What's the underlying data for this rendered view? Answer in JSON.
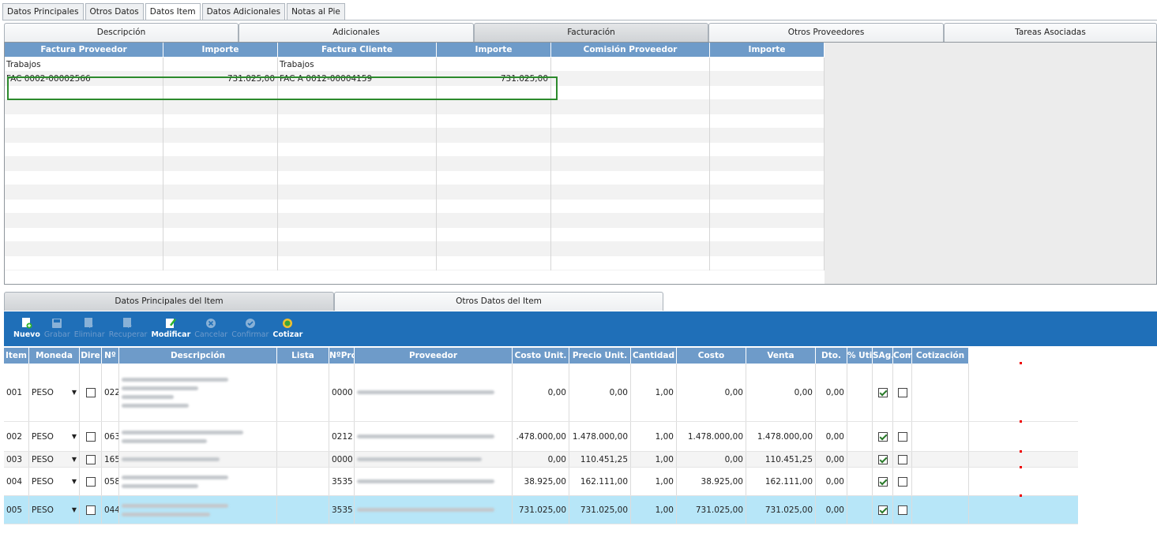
{
  "top_tabs": [
    "Datos Principales",
    "Otros Datos",
    "Datos Item",
    "Datos Adicionales",
    "Notas al Pie"
  ],
  "sub_tabs": [
    "Descripción",
    "Adicionales",
    "Facturación",
    "Otros Proveedores",
    "Tareas Asociadas"
  ],
  "facturacion": {
    "headers": [
      "Factura Proveedor",
      "Importe",
      "Factura Cliente",
      "Importe",
      "Comisión Proveedor",
      "Importe"
    ],
    "group_label_left": "Trabajos",
    "group_label_right": "Trabajos",
    "row": {
      "factura_proveedor": "FAC 0002-00002566",
      "importe_prov": "731.025,00",
      "factura_cliente": "FAC A 0012-00004159",
      "importe_cliente": "731.025,00"
    }
  },
  "item_tabs": [
    "Datos Principales del Item",
    "Otros Datos del Item"
  ],
  "toolbar": {
    "nuevo": "Nuevo",
    "grabar": "Grabar",
    "eliminar": "Eliminar",
    "recuperar": "Recuperar",
    "modificar": "Modificar",
    "cancelar": "Cancelar",
    "confirmar": "Confirmar",
    "cotizar": "Cotizar"
  },
  "items_grid": {
    "headers": [
      "Item",
      "Moneda",
      "Dire",
      "Nº",
      "Descripción",
      "Lista",
      "NºProv",
      "Proveedor",
      "Costo Unit.",
      "Precio Unit.",
      "Cantidad",
      "Costo",
      "Venta",
      "Dto.",
      "% Util",
      "SAg.",
      "Com",
      "Cotización"
    ],
    "rows": [
      {
        "item": "001",
        "moneda": "PESO",
        "nro": "022",
        "nprov": "0000",
        "costo_unit": "0,00",
        "precio_unit": "0,00",
        "cantidad": "1,00",
        "costo": "0,00",
        "venta": "0,00",
        "dto": "0,00",
        "sag": true,
        "com": false
      },
      {
        "item": "002",
        "moneda": "PESO",
        "nro": "063",
        "nprov": "0212",
        "costo_unit": ".478.000,00",
        "precio_unit": "1.478.000,00",
        "cantidad": "1,00",
        "costo": "1.478.000,00",
        "venta": "1.478.000,00",
        "dto": "0,00",
        "sag": true,
        "com": false
      },
      {
        "item": "003",
        "moneda": "PESO",
        "nro": "165",
        "nprov": "0000",
        "costo_unit": "0,00",
        "precio_unit": "110.451,25",
        "cantidad": "1,00",
        "costo": "0,00",
        "venta": "110.451,25",
        "dto": "0,00",
        "sag": true,
        "com": false
      },
      {
        "item": "004",
        "moneda": "PESO",
        "nro": "058",
        "nprov": "3535",
        "costo_unit": "38.925,00",
        "precio_unit": "162.111,00",
        "cantidad": "1,00",
        "costo": "38.925,00",
        "venta": "162.111,00",
        "dto": "0,00",
        "sag": true,
        "com": false
      },
      {
        "item": "005",
        "moneda": "PESO",
        "nro": "044",
        "nprov": "3535",
        "costo_unit": "731.025,00",
        "precio_unit": "731.025,00",
        "cantidad": "1,00",
        "costo": "731.025,00",
        "venta": "731.025,00",
        "dto": "0,00",
        "sag": true,
        "com": false
      }
    ]
  },
  "colors": {
    "header_blue": "#6e9bc9",
    "toolbar_blue": "#1f6fb8",
    "selected_row": "#b7e6f8",
    "highlight_border": "#2c8a2c"
  }
}
